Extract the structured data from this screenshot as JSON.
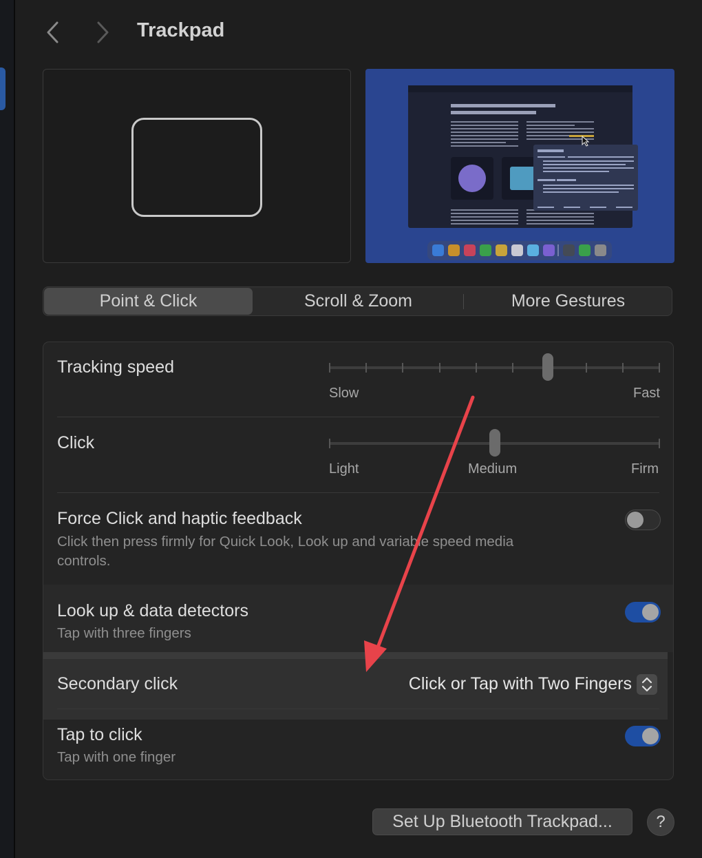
{
  "window": {
    "title": "Trackpad"
  },
  "tabs": [
    {
      "label": "Point & Click",
      "active": true
    },
    {
      "label": "Scroll & Zoom",
      "active": false
    },
    {
      "label": "More Gestures",
      "active": false
    }
  ],
  "tracking_speed": {
    "label": "Tracking speed",
    "min_label": "Slow",
    "max_label": "Fast",
    "position": 0.667,
    "ticks": 10
  },
  "click": {
    "label": "Click",
    "min_label": "Light",
    "mid_label": "Medium",
    "max_label": "Firm",
    "position": 0.5
  },
  "force_click": {
    "label": "Force Click and haptic feedback",
    "description": "Click then press firmly for Quick Look, Look up and variable speed media controls.",
    "enabled": false
  },
  "look_up": {
    "label": "Look up & data detectors",
    "description": "Tap with three fingers",
    "enabled": true
  },
  "secondary_click": {
    "label": "Secondary click",
    "value": "Click or Tap with Two Fingers"
  },
  "tap_to_click": {
    "label": "Tap to click",
    "description": "Tap with one finger",
    "enabled": true
  },
  "footer": {
    "setup_button": "Set Up Bluetooth Trackpad...",
    "help_button": "?"
  },
  "colors": {
    "accent": "#1e4ea3",
    "annotation_arrow": "#e8434a",
    "preview_bg": "#2a4590"
  }
}
